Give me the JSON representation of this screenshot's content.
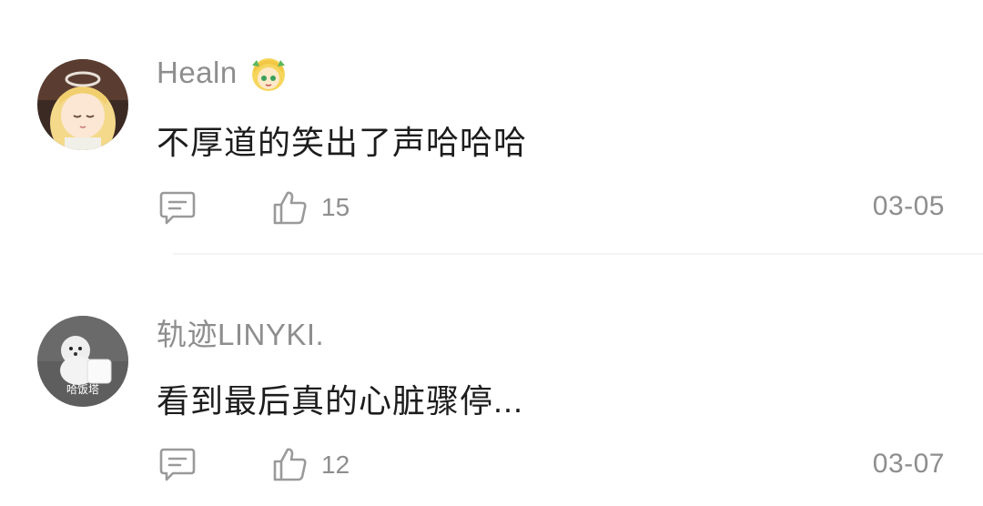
{
  "comments": [
    {
      "username": "Healn",
      "badge_icon": "anime-avatar-badge-icon",
      "text": "不厚道的笑出了声哈哈哈",
      "like_count": "15",
      "date": "03-05"
    },
    {
      "username": "轨迹LINYKI.",
      "text": "看到最后真的心脏骤停...",
      "like_count": "12",
      "date": "03-07",
      "avatar_caption": "哈饭塔"
    }
  ],
  "icons": {
    "reply": "comment-bubble-icon",
    "like": "thumbs-up-icon"
  },
  "colors": {
    "secondary_text": "#8e8e8e",
    "primary_text": "#1c1c1c",
    "divider": "#f3f3f3"
  }
}
